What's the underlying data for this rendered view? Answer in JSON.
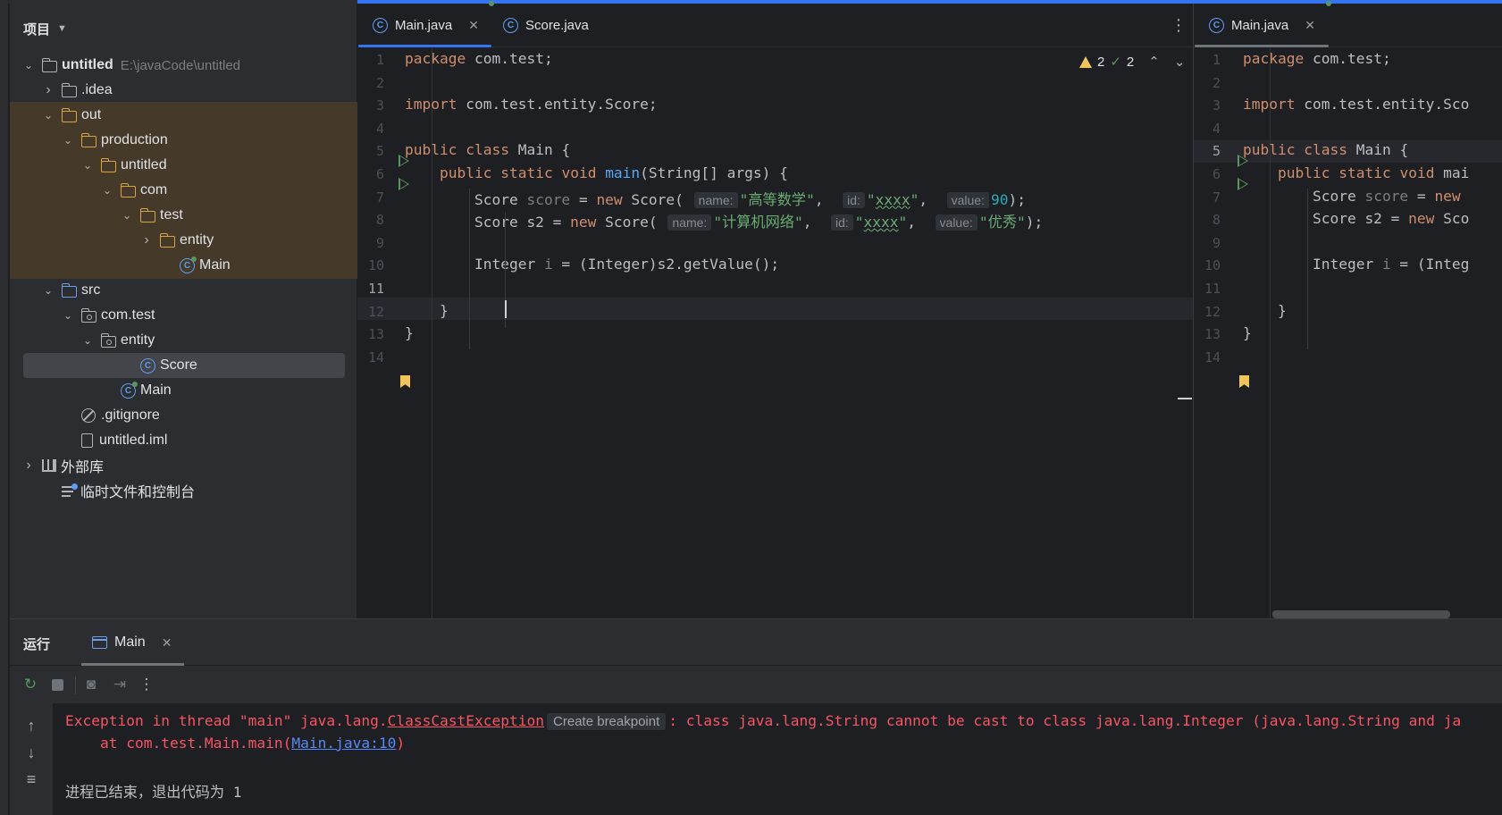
{
  "project_panel": {
    "title": "项目",
    "tree": [
      {
        "label": "untitled",
        "path": "E:\\javaCode\\untitled",
        "arrow": "open",
        "icon": "module-folder-icon",
        "bold": true
      },
      {
        "label": ".idea",
        "arrow": "closed",
        "icon": "folder-icon"
      },
      {
        "label": "out",
        "arrow": "open",
        "icon": "folder-icon-orange"
      },
      {
        "label": "production",
        "arrow": "open",
        "icon": "folder-icon-orange"
      },
      {
        "label": "untitled",
        "arrow": "open",
        "icon": "folder-icon-orange"
      },
      {
        "label": "com",
        "arrow": "open",
        "icon": "folder-icon-orange"
      },
      {
        "label": "test",
        "arrow": "open",
        "icon": "folder-icon-orange"
      },
      {
        "label": "entity",
        "arrow": "closed",
        "icon": "folder-icon-orange"
      },
      {
        "label": "Main",
        "icon": "class-run-icon"
      },
      {
        "label": "src",
        "arrow": "open",
        "icon": "source-folder-icon"
      },
      {
        "label": "com.test",
        "arrow": "open",
        "icon": "package-icon"
      },
      {
        "label": "entity",
        "arrow": "open",
        "icon": "package-icon"
      },
      {
        "label": "Score",
        "icon": "class-icon",
        "selected": true
      },
      {
        "label": "Main",
        "icon": "class-run-icon"
      },
      {
        "label": ".gitignore",
        "icon": "ignore-file-icon"
      },
      {
        "label": "untitled.iml",
        "icon": "module-file-icon"
      },
      {
        "label": "外部库",
        "arrow": "closed",
        "icon": "library-icon"
      },
      {
        "label": "临时文件和控制台",
        "icon": "scratches-icon"
      }
    ]
  },
  "editor_tabs": [
    {
      "label": "Main.java",
      "active": true,
      "closable": true
    },
    {
      "label": "Score.java",
      "active": false
    }
  ],
  "split_tabs": [
    {
      "label": "Main.java",
      "active": true,
      "closable": true
    }
  ],
  "close_glyph": "✕",
  "more_glyph": "⋮",
  "inspection": {
    "warnings": "2",
    "weak_warnings": "2",
    "up": "⌃",
    "down": "⌄"
  },
  "editor": {
    "current_line": 11,
    "line_numbers": [
      "1",
      "2",
      "3",
      "4",
      "5",
      "6",
      "7",
      "8",
      "9",
      "10",
      "11",
      "12",
      "13",
      "14"
    ],
    "run_gutter_lines": [
      5,
      6
    ],
    "bookmark_line": 14,
    "lines": [
      "package com.test;",
      "",
      "import com.test.entity.Score;",
      "",
      "public class Main {",
      "    public static void main(String[] args) {",
      "        Score score = new Score( name: \"高等数学\",  id: \"xxxx\",  value: 90);",
      "        Score s2 = new Score( name: \"计算机网络\",  id: \"xxxx\",  value: \"优秀\");",
      "",
      "        Integer i = (Integer)s2.getValue();",
      "",
      "    }",
      "}",
      ""
    ],
    "split_lines": [
      "package com.test;",
      "",
      "import com.test.entity.Sco",
      "",
      "public class Main {",
      "    public static void mai",
      "        Score score = new ",
      "        Score s2 = new Sco",
      "",
      "        Integer i = (Integ",
      "",
      "    }",
      "}",
      ""
    ]
  },
  "run_panel": {
    "title": "运行",
    "tab_label": "Main",
    "toolbar": [
      "rerun-icon",
      "stop-icon",
      "camera-icon",
      "exit-icon",
      "more-icon"
    ],
    "side": [
      "scroll-up-icon",
      "scroll-down-icon",
      "soft-wrap-icon"
    ],
    "output": {
      "line1_prefix": "Exception in thread \"main\" java.lang.",
      "line1_link": "ClassCastException",
      "breakpoint_hint": "Create breakpoint",
      "line1_suffix": ": class java.lang.String cannot be cast to class java.lang.Integer (java.lang.String and ja",
      "line2_prefix": "    at com.test.Main.main(",
      "line2_link": "Main.java:10",
      "line2_suffix": ")",
      "exit_message": "进程已结束，退出代码为 1"
    }
  }
}
